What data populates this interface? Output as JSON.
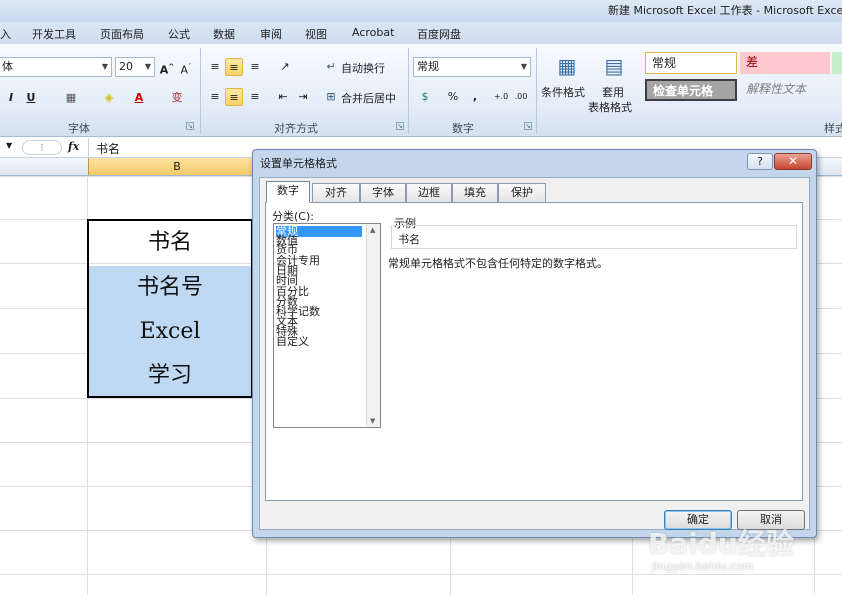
{
  "window": {
    "title": "新建 Microsoft Excel 工作表 - Microsoft Excel"
  },
  "ribbon_tabs": [
    "入",
    "开发工具",
    "页面布局",
    "公式",
    "数据",
    "审阅",
    "视图",
    "Acrobat",
    "百度网盘"
  ],
  "ribbon": {
    "font_name": "体",
    "font_size": "20",
    "font_group_label": "字体",
    "wrap_text": "自动换行",
    "merge_center": "合并后居中",
    "align_group_label": "对齐方式",
    "number_format": "常规",
    "number_group_label": "数字",
    "conditional_format": "条件格式",
    "apply": "套用",
    "table_format": "表格格式",
    "styles_group_label": "样式",
    "style_normal": "常规",
    "style_bad": "差",
    "style_check_cell": "检查单元格",
    "style_explanatory": "解释性文本"
  },
  "formula_bar": {
    "fx": "fx",
    "content": "书名"
  },
  "sheet": {
    "column_header": "B",
    "cells": [
      "书名",
      "书名号",
      "Excel",
      "学习"
    ]
  },
  "dialog": {
    "title": "设置单元格格式",
    "help": "?",
    "close": "✕",
    "tabs": [
      "数字",
      "对齐",
      "字体",
      "边框",
      "填充",
      "保护"
    ],
    "category_label": "分类(C):",
    "categories": [
      "常规",
      "数值",
      "货币",
      "会计专用",
      "日期",
      "时间",
      "百分比",
      "分数",
      "科学记数",
      "文本",
      "特殊",
      "自定义"
    ],
    "selected_category": "常规",
    "sample_label": "示例",
    "sample_value": "书名",
    "description": "常规单元格格式不包含任何特定的数字格式。",
    "ok": "确定",
    "cancel": "取消"
  },
  "watermark": {
    "main": "Baidu经验",
    "sub": "jingyan.baidu.com"
  }
}
